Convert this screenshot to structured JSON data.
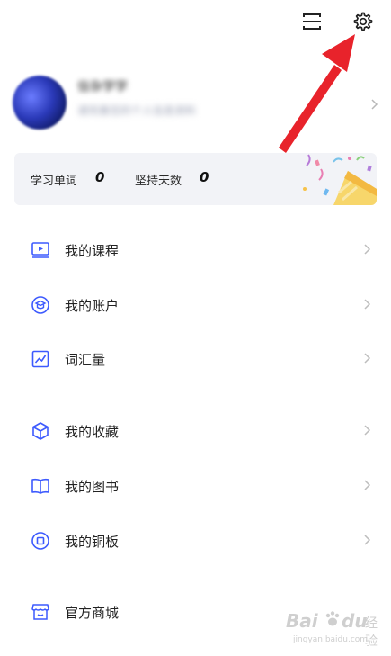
{
  "profile": {
    "username": "信杂学学",
    "subtitle": "请完善您的个人信息资料"
  },
  "stats": {
    "words_label": "学习单词",
    "words_value": "0",
    "days_label": "坚持天数",
    "days_value": "0"
  },
  "menu": [
    {
      "label": "我的课程",
      "icon": "course-icon"
    },
    {
      "label": "我的账户",
      "icon": "account-icon"
    },
    {
      "label": "词汇量",
      "icon": "vocabulary-icon"
    },
    {
      "label": "我的收藏",
      "icon": "favorites-icon"
    },
    {
      "label": "我的图书",
      "icon": "books-icon"
    },
    {
      "label": "我的铜板",
      "icon": "coin-icon"
    },
    {
      "label": "官方商城",
      "icon": "store-icon"
    }
  ],
  "watermark": {
    "brand": "Bai",
    "paw": "du",
    "jingyan": "经验",
    "url": "jingyan.baidu.com"
  },
  "colors": {
    "accent": "#3d5afe",
    "annotation_arrow": "#e8232b",
    "stats_bg": "#f2f3f7"
  }
}
